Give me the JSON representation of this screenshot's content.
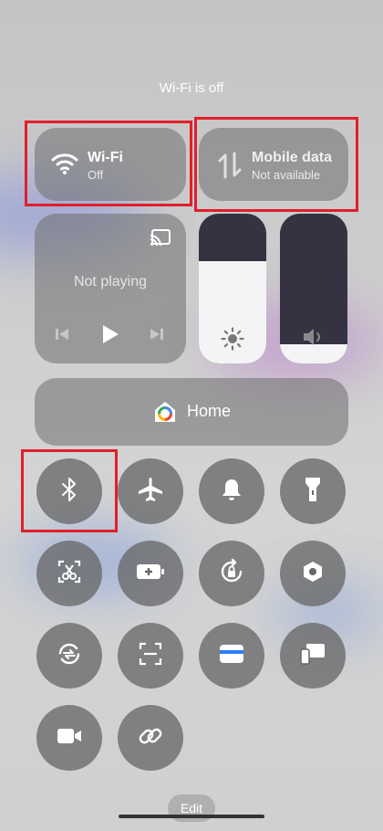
{
  "status_text": "Wi-Fi is off",
  "wifi_tile": {
    "title": "Wi-Fi",
    "subtitle": "Off"
  },
  "mobile_tile": {
    "title": "Mobile data",
    "subtitle": "Not available"
  },
  "media": {
    "status": "Not playing"
  },
  "brightness": {
    "level": 0.68
  },
  "volume": {
    "level": 0.13
  },
  "home_tile": {
    "label": "Home"
  },
  "toggles": [
    {
      "name": "bluetooth-icon",
      "active": false
    },
    {
      "name": "airplane-icon",
      "active": false
    },
    {
      "name": "bell-icon",
      "active": false
    },
    {
      "name": "flashlight-icon",
      "active": false
    },
    {
      "name": "screenshot-icon",
      "active": false
    },
    {
      "name": "battery-saver-icon",
      "active": false
    },
    {
      "name": "rotation-lock-icon",
      "active": true
    },
    {
      "name": "settings-hexagon-icon",
      "active": false
    },
    {
      "name": "sync-icon",
      "active": false
    },
    {
      "name": "scanner-icon",
      "active": false
    },
    {
      "name": "wallet-icon",
      "active": true
    },
    {
      "name": "cast-devices-icon",
      "active": false
    },
    {
      "name": "screen-record-icon",
      "active": false
    },
    {
      "name": "link-icon",
      "active": false
    }
  ],
  "edit_label": "Edit",
  "colors": {
    "accent": "#2d7cf6",
    "highlight": "#e01f2a"
  }
}
